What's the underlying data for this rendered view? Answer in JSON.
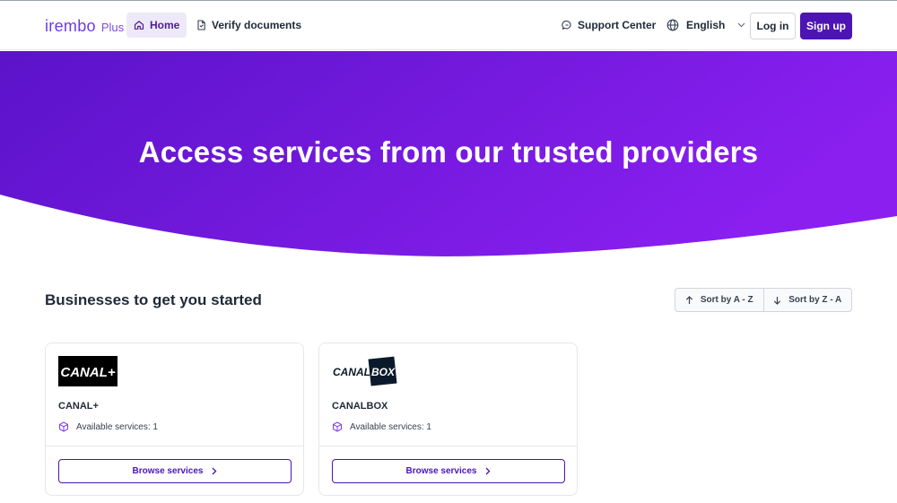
{
  "header": {
    "logo_text": "irembo",
    "logo_plus": "Plus",
    "nav": {
      "home": "Home",
      "verify": "Verify documents"
    },
    "support": "Support Center",
    "language": "English",
    "login": "Log in",
    "signup": "Sign up"
  },
  "hero": {
    "title": "Access services from our trusted providers"
  },
  "section": {
    "title": "Businesses to get you started",
    "sort_az": "Sort by A - Z",
    "sort_za": "Sort by Z - A"
  },
  "cards": [
    {
      "logo_text": "CANAL+",
      "name": "CANAL+",
      "services": "Available services: 1",
      "browse": "Browse services"
    },
    {
      "logo_text_left": "CANAL",
      "logo_text_right": "BOX",
      "name": "CANALBOX",
      "services": "Available services: 1",
      "browse": "Browse services"
    }
  ],
  "colors": {
    "brand": "#4c14b4",
    "hero_left": "#5b13c9",
    "hero_right": "#8a1ff0"
  }
}
